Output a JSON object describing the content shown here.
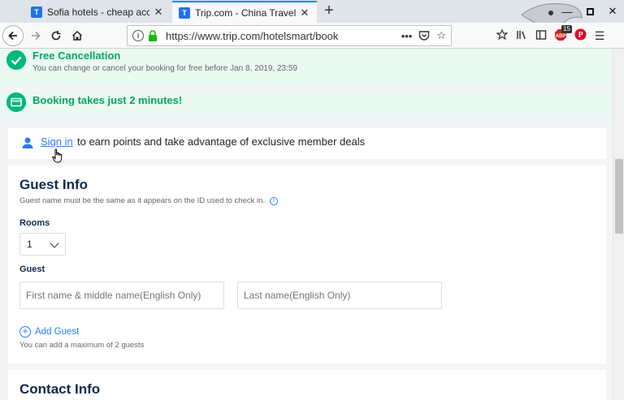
{
  "browser": {
    "tabs": [
      {
        "title": "Sofia hotels - cheap accommo",
        "favicon": "T",
        "active": false
      },
      {
        "title": "Trip.com - China Travel, Cheap",
        "favicon": "T",
        "active": true
      }
    ],
    "url": "https://www.trip.com/hotelsmart/book",
    "badge_count": "15",
    "icons": [
      "back-icon",
      "forward-icon",
      "reload-icon",
      "home-icon",
      "info-icon",
      "lock-icon",
      "more-icon",
      "pocket-icon",
      "bookmark-star-icon",
      "library-icon",
      "sidebar-icon",
      "adblock-icon",
      "pinterest-icon",
      "menu-icon"
    ]
  },
  "banners": {
    "cancel_title": "Free Cancellation",
    "cancel_sub": "You can change or cancel your booking for free before Jan 8, 2019, 23:59",
    "quick_title": "Booking takes just 2 minutes!"
  },
  "signin": {
    "link": "Sign in",
    "text": "to earn points and take advantage of exclusive member deals"
  },
  "guest_info": {
    "title": "Guest Info",
    "subtitle": "Guest name must be the same as it appears on the ID used to check in.",
    "rooms_label": "Rooms",
    "rooms_value": "1",
    "guest_label": "Guest",
    "first_name_placeholder": "First name & middle name(English Only)",
    "last_name_placeholder": "Last name(English Only)",
    "add_guest": "Add Guest",
    "add_note": "You can add a maximum of 2 guests"
  },
  "contact": {
    "title": "Contact Info"
  },
  "colors": {
    "accent_blue": "#287dfa",
    "success_green": "#00a765",
    "banner_bg": "#eafaf2",
    "heading": "#0f294d"
  }
}
